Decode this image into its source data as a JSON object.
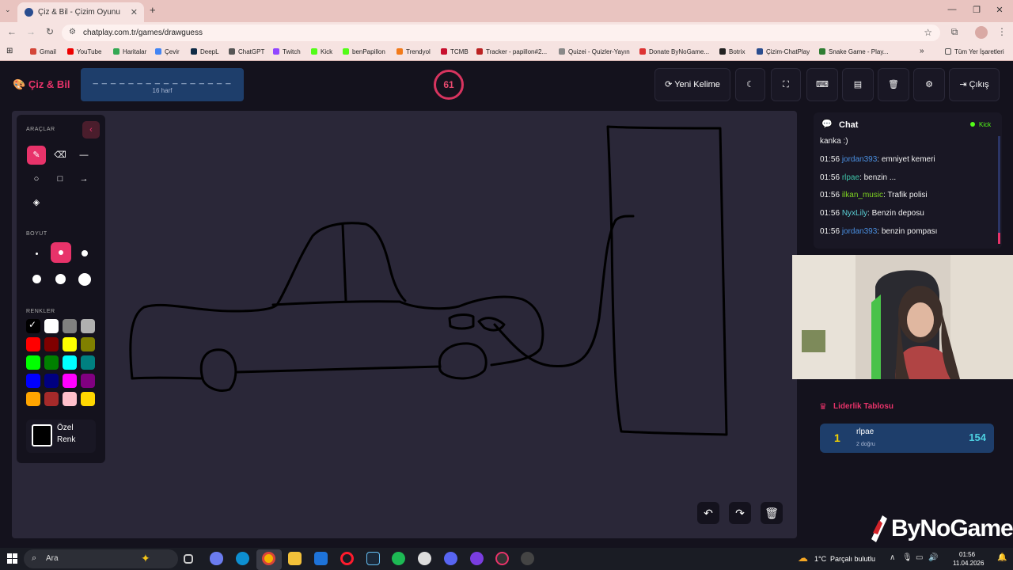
{
  "browser": {
    "tab_title": "Çiz & Bil - Çizim Oyunu",
    "url": "chatplay.com.tr/games/drawguess",
    "bookmarks": [
      "Gmail",
      "YouTube",
      "Haritalar",
      "Çevir",
      "DeepL",
      "ChatGPT",
      "Twitch",
      "Kick",
      "benPapillon",
      "Trendyol",
      "TCMB",
      "Tracker - papillon#2...",
      "Quizei - Quizler-Yayın",
      "Donate ByNoGame...",
      "Botrix",
      "Çizim-ChatPlay",
      "Snake Game - Play..."
    ],
    "all_bookmarks": "Tüm Yer İşaretleri"
  },
  "header": {
    "logo": "Çiz & Bil",
    "word_mask": "_ _ _ _ _ _ _ _ _ _ _ _ _ _ _ _",
    "word_hint": "16 harf",
    "timer": "61",
    "new_word": "Yeni Kelime",
    "exit": "Çıkış"
  },
  "tools": {
    "tools_label": "ARAÇLAR",
    "size_label": "BOYUT",
    "colors_label": "RENKLER",
    "custom_color_line1": "Özel",
    "custom_color_line2": "Renk",
    "colors": [
      "#000000",
      "#ffffff",
      "#808080",
      "#b0b0b0",
      "#ff0000",
      "#800000",
      "#ffff00",
      "#808000",
      "#00ff00",
      "#008000",
      "#00ffff",
      "#008080",
      "#0000ff",
      "#000080",
      "#ff00ff",
      "#800080",
      "#ffa500",
      "#a52a2a",
      "#ffc0cb",
      "#ffd700"
    ],
    "accent": "#e8336a"
  },
  "chat": {
    "title": "Chat",
    "platform": "Kick",
    "top_fragment": "kanka :)",
    "messages": [
      {
        "time": "01:56",
        "user": "jordan393",
        "color": "#4a90e2",
        "text": ": emniyet kemeri"
      },
      {
        "time": "01:56",
        "user": "rlpae",
        "color": "#3ec4a8",
        "text": ": benzin ..."
      },
      {
        "time": "01:56",
        "user": "ilkan_music",
        "color": "#7ed321",
        "text": ": Trafik polisi"
      },
      {
        "time": "01:56",
        "user": "NyxLily",
        "color": "#5bd1d7",
        "text": ": Benzin deposu"
      },
      {
        "time": "01:56",
        "user": "jordan393",
        "color": "#4a90e2",
        "text": ": benzin pompası"
      }
    ]
  },
  "leaderboard": {
    "title": "Liderlik Tablosu",
    "entries": [
      {
        "rank": "1",
        "name": "rlpae",
        "sub": "2 doğru",
        "score": "154"
      }
    ]
  },
  "watermark": "ByNoGame",
  "taskbar": {
    "search": "Ara",
    "weather": "1°C",
    "weather_text": "Parçalı bulutlu",
    "time": "01:56",
    "date": "11.04.2026"
  }
}
